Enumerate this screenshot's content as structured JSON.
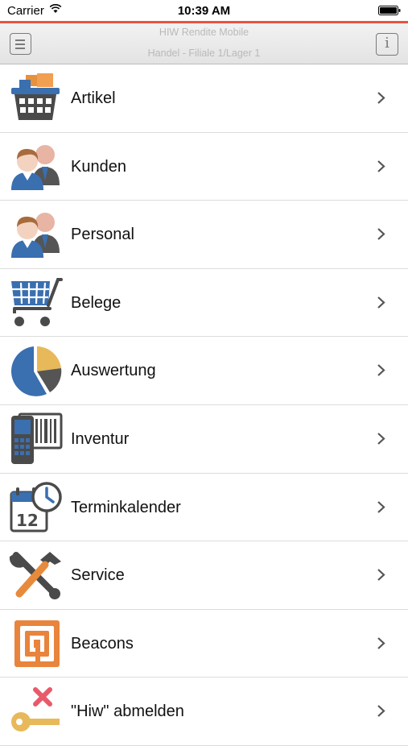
{
  "status_bar": {
    "carrier": "Carrier",
    "time": "10:39 AM"
  },
  "accent_color": "#e8543f",
  "nav": {
    "title": "HIW Rendite Mobile",
    "subtitle": "Handel - Filiale 1/Lager 1",
    "info_label": "i"
  },
  "menu": [
    {
      "label": "Artikel",
      "icon": "basket-icon"
    },
    {
      "label": "Kunden",
      "icon": "customers-icon"
    },
    {
      "label": "Personal",
      "icon": "staff-icon"
    },
    {
      "label": "Belege",
      "icon": "shopping-cart-icon"
    },
    {
      "label": "Auswertung",
      "icon": "pie-chart-icon"
    },
    {
      "label": "Inventur",
      "icon": "barcode-scanner-icon"
    },
    {
      "label": "Terminkalender",
      "icon": "calendar-clock-icon"
    },
    {
      "label": "Service",
      "icon": "tools-icon"
    },
    {
      "label": "Beacons",
      "icon": "beacon-icon"
    },
    {
      "label": "\"Hiw\" abmelden",
      "icon": "logout-key-icon"
    }
  ]
}
